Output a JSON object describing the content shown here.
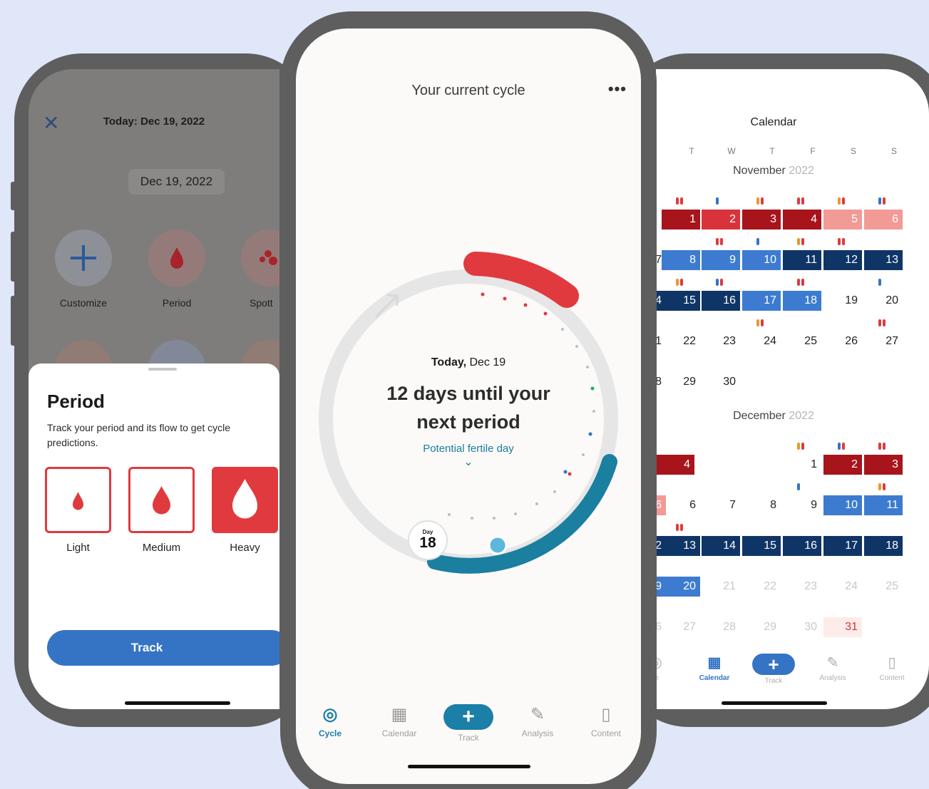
{
  "left": {
    "header_title": "Today: Dec 19, 2022",
    "date_pill": "Dec 19, 2022",
    "chips": [
      {
        "label": "Customize",
        "icon": "plus-icon"
      },
      {
        "label": "Period",
        "icon": "blood-drop-icon"
      },
      {
        "label": "Spott",
        "icon": "spotting-icon"
      }
    ],
    "sheet": {
      "title": "Period",
      "description": "Track your period and its flow to get cycle predictions.",
      "options": [
        {
          "label": "Light",
          "selected": false
        },
        {
          "label": "Medium",
          "selected": false
        },
        {
          "label": "Heavy",
          "selected": true
        }
      ],
      "track_label": "Track"
    }
  },
  "center": {
    "title": "Your current cycle",
    "more": "•••",
    "today_label": "Today,",
    "today_date": "Dec 19",
    "headline_line1": "12 days until your",
    "headline_line2": "next period",
    "fertile_label": "Potential fertile day",
    "day_label": "Day",
    "day_number": "18",
    "nav": [
      {
        "label": "Cycle",
        "icon": "cycle-icon",
        "active": true
      },
      {
        "label": "Calendar",
        "icon": "calendar-icon",
        "active": false
      },
      {
        "label": "Track",
        "icon": "plus-icon",
        "active": false
      },
      {
        "label": "Analysis",
        "icon": "analysis-icon",
        "active": false
      },
      {
        "label": "Content",
        "icon": "book-icon",
        "active": false
      }
    ],
    "colors": {
      "period": "#e03a3e",
      "fertile": "#1a7e9c",
      "ring": "#e8e8e8"
    }
  },
  "right": {
    "title": "Calendar",
    "weekdays": [
      "T",
      "W",
      "T",
      "F",
      "S",
      "S"
    ],
    "november": {
      "name": "November",
      "year": "2022"
    },
    "december": {
      "name": "December",
      "year": "2022"
    },
    "nov_rows": [
      [
        "1",
        "2",
        "3",
        "4",
        "5",
        "6"
      ],
      [
        "8",
        "9",
        "10",
        "11",
        "12",
        "13"
      ],
      [
        "15",
        "16",
        "17",
        "18",
        "19",
        "20"
      ],
      [
        "22",
        "23",
        "24",
        "25",
        "26",
        "27"
      ],
      [
        "29",
        "30"
      ]
    ],
    "dec_rows": [
      [
        "1",
        "2",
        "3",
        "4"
      ],
      [
        "6",
        "7",
        "8",
        "9",
        "10",
        "11"
      ],
      [
        "13",
        "14",
        "15",
        "16",
        "17",
        "18"
      ],
      [
        "20",
        "21",
        "22",
        "23",
        "24",
        "25"
      ],
      [
        "27",
        "28",
        "29",
        "30",
        "31"
      ]
    ],
    "cut_left": {
      "nov": [
        "7",
        "4",
        "1",
        "8"
      ],
      "dec": [
        "6",
        "2",
        "9",
        "6"
      ]
    },
    "nav": [
      {
        "label": "le",
        "active": false
      },
      {
        "label": "Calendar",
        "active": true
      },
      {
        "label": "Track",
        "active": false
      },
      {
        "label": "Analysis",
        "active": false
      },
      {
        "label": "Content",
        "active": false
      }
    ]
  }
}
